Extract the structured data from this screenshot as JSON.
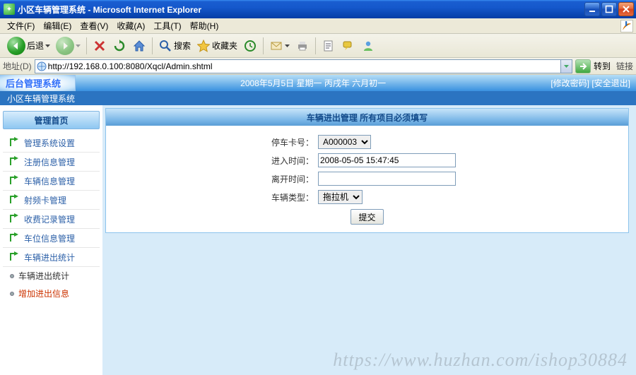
{
  "browser": {
    "window_title": "小区车辆管理系统 - Microsoft Internet Explorer",
    "menus": {
      "file": "文件(F)",
      "edit": "编辑(E)",
      "view": "查看(V)",
      "fav": "收藏(A)",
      "tools": "工具(T)",
      "help": "帮助(H)"
    },
    "toolbar": {
      "back": "后退",
      "search": "搜索",
      "favorites": "收藏夹"
    },
    "address": {
      "label": "地址(D)",
      "url": "http://192.168.0.100:8080/Xqcl/Admin.shtml",
      "go": "转到",
      "links": "链接"
    }
  },
  "app": {
    "brand": "后台管理系统",
    "date_text": "2008年5月5日 星期一 丙戌年 六月初一",
    "right_links": {
      "change_pwd": "[修改密码]",
      "logout": "[安全退出]"
    },
    "subtitle": "小区车辆管理系统",
    "sidebar": {
      "home": "管理首页",
      "items": [
        {
          "label": "管理系统设置"
        },
        {
          "label": "注册信息管理"
        },
        {
          "label": "车辆信息管理"
        },
        {
          "label": "射频卡管理"
        },
        {
          "label": "收费记录管理"
        },
        {
          "label": "车位信息管理"
        },
        {
          "label": "车辆进出统计"
        }
      ],
      "bullets": [
        {
          "label": "车辆进出统计",
          "active": false
        },
        {
          "label": "增加进出信息",
          "active": true
        }
      ]
    },
    "panel": {
      "title": "车辆进出管理 所有项目必须填写",
      "card_label": "停车卡号：",
      "card_value": "A000003",
      "enter_label": "进入时间：",
      "enter_value": "2008-05-05 15:47:45",
      "leave_label": "离开时间：",
      "leave_value": "",
      "type_label": "车辆类型：",
      "type_value": "拖拉机",
      "submit": "提交"
    }
  },
  "watermark": "https://www.huzhan.com/ishop30884"
}
